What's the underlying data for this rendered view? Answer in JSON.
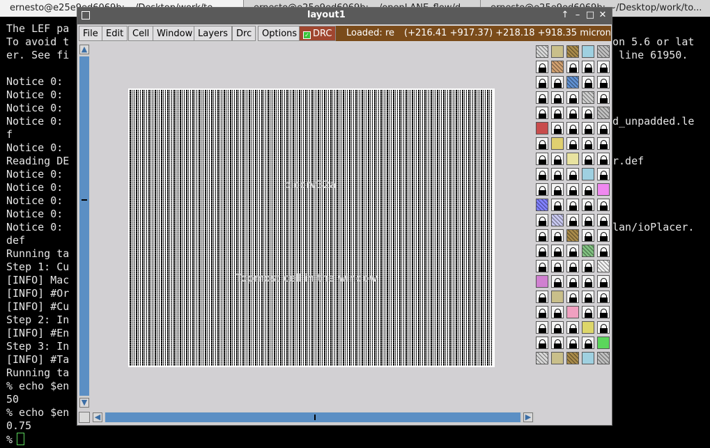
{
  "terminal_tabs": [
    "ernesto@e25e9ed6069b: ~/Desktop/work/te...",
    "ernesto@e25e9ed6069b: ~/openLANE_flow/d...",
    "ernesto@e25e9ed6069b: ~/Desktop/work/to..."
  ],
  "terminal_lines": [
    "The LEF pa",
    "To avoid t",
    "er. See fi",
    "",
    "Notice 0:",
    "Notice 0:",
    "Notice 0:",
    "Notice 0:",
    "f",
    "Notice 0:",
    "Reading DE",
    "Notice 0:",
    "Notice 0:",
    "Notice 0:",
    "Notice 0:",
    "Notice 0:",
    "def",
    "Running ta",
    "Step 1: Cu",
    "[INFO] Mac",
    "[INFO] #Or",
    "[INFO] #Cu",
    "Step 2: In",
    "[INFO] #En",
    "Step 3: In",
    "[INFO] #Ta",
    "Running ta",
    "% echo $en",
    "50",
    "% echo $en",
    "0.75",
    "%"
  ],
  "terminal_right": [
    {
      "row": 1,
      "text": "on 5.6 or lat"
    },
    {
      "row": 2,
      "text": " line 61950."
    },
    {
      "row": 7,
      "text": "d_unpadded.le"
    },
    {
      "row": 10,
      "text": "r.def"
    },
    {
      "row": 15,
      "text": "lan/ioPlacer."
    }
  ],
  "window": {
    "title": "layout1",
    "menu": [
      "File",
      "Edit",
      "Cell",
      "Window",
      "Layers",
      "Drc",
      "Options"
    ],
    "drc_label": "DRC",
    "status_loaded": "Loaded: re",
    "status_coords": "(+216.41 +917.37) +218.18 +918.35 microns",
    "cell_name": "picorv32a",
    "cell_hint": "Topmost cell in the window"
  },
  "colors": {
    "titlebar": "#5a5a5a",
    "drc_button": "#a0462f",
    "status_bar": "#7a4b1a",
    "scrollbar": "#5b8fc4",
    "window_bg": "#d2d0d3"
  }
}
